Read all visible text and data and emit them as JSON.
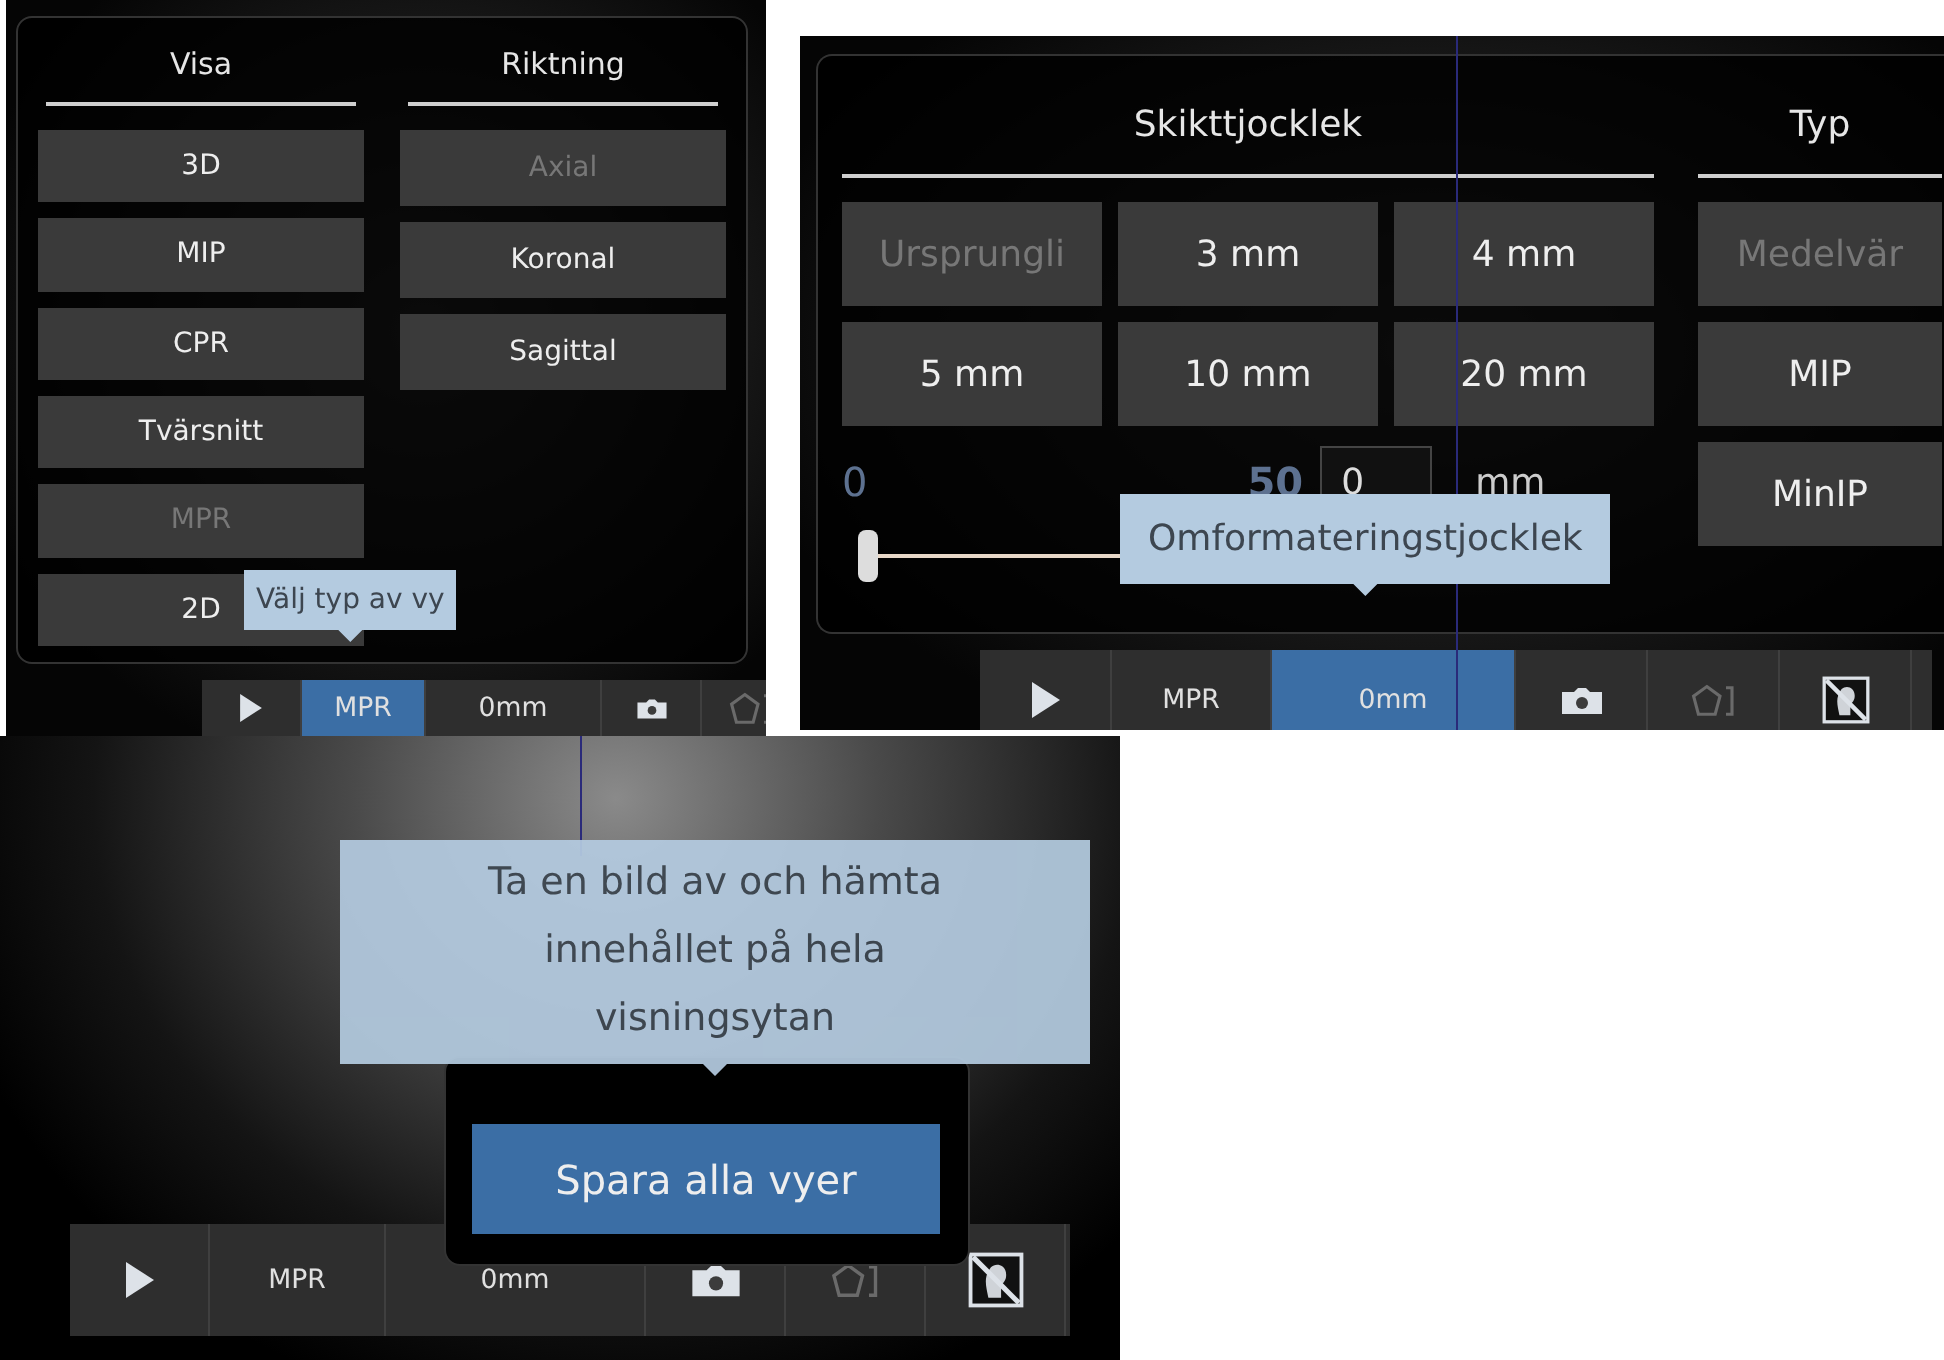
{
  "panels": [
    {
      "kind": "view_menu",
      "columns": [
        {
          "heading": "Visa",
          "items": [
            {
              "label": "3D",
              "disabled": false
            },
            {
              "label": "MIP",
              "disabled": false
            },
            {
              "label": "CPR",
              "disabled": false
            },
            {
              "label": "Tvärsnitt",
              "disabled": false
            },
            {
              "label": "MPR",
              "disabled": true
            },
            {
              "label": "2D",
              "disabled": false
            }
          ]
        },
        {
          "heading": "Riktning",
          "items": [
            {
              "label": "Axial",
              "disabled": true
            },
            {
              "label": "Koronal",
              "disabled": false
            },
            {
              "label": "Sagittal",
              "disabled": false
            }
          ]
        }
      ],
      "tooltip": "Välj typ av vy",
      "toolbar": [
        {
          "kind": "play",
          "selected": false,
          "disabled": false
        },
        {
          "kind": "text",
          "label": "MPR",
          "selected": true,
          "disabled": false
        },
        {
          "kind": "text",
          "label": "0mm",
          "selected": false,
          "disabled": false
        },
        {
          "kind": "camera",
          "selected": false,
          "disabled": false
        },
        {
          "kind": "shape",
          "selected": false,
          "disabled": true
        }
      ]
    },
    {
      "kind": "thickness_menu",
      "sections": [
        {
          "heading": "Skikttjocklek",
          "items": [
            {
              "label": "Ursprungli",
              "disabled": true
            },
            {
              "label": "3 mm",
              "disabled": false
            },
            {
              "label": "4 mm",
              "disabled": false
            },
            {
              "label": "5 mm",
              "disabled": false
            },
            {
              "label": "10 mm",
              "disabled": false
            },
            {
              "label": "20 mm",
              "disabled": false
            }
          ]
        },
        {
          "heading": "Typ",
          "items": [
            {
              "label": "Medelvär",
              "disabled": true
            },
            {
              "label": "MIP",
              "disabled": false
            },
            {
              "label": "MinIP",
              "disabled": false
            }
          ]
        }
      ],
      "slider": {
        "min_label": "0",
        "max_label": "50",
        "level": 0,
        "value": "0",
        "unit": "mm"
      },
      "tooltip": "Omformateringstjocklek",
      "toolbar": [
        {
          "kind": "play",
          "selected": false,
          "disabled": false
        },
        {
          "kind": "text",
          "label": "MPR",
          "selected": false,
          "disabled": false
        },
        {
          "kind": "text",
          "label": "0mm",
          "selected": true,
          "disabled": false
        },
        {
          "kind": "camera",
          "selected": false,
          "disabled": false
        },
        {
          "kind": "shape",
          "selected": false,
          "disabled": true
        },
        {
          "kind": "face",
          "selected": false,
          "disabled": false
        }
      ]
    },
    {
      "kind": "save_menu",
      "buttons": [
        {
          "label": "Spara alla vyer",
          "selected": true
        }
      ],
      "tooltip": "Ta en bild av och hämta innehållet på hela visningsytan",
      "toolbar": [
        {
          "kind": "play",
          "selected": false,
          "disabled": false
        },
        {
          "kind": "text",
          "label": "MPR",
          "selected": false,
          "disabled": false
        },
        {
          "kind": "text",
          "label": "0mm",
          "selected": false,
          "disabled": false
        },
        {
          "kind": "camera",
          "selected": false,
          "disabled": false
        },
        {
          "kind": "shape",
          "selected": false,
          "disabled": true
        },
        {
          "kind": "face",
          "selected": false,
          "disabled": false
        }
      ]
    }
  ]
}
